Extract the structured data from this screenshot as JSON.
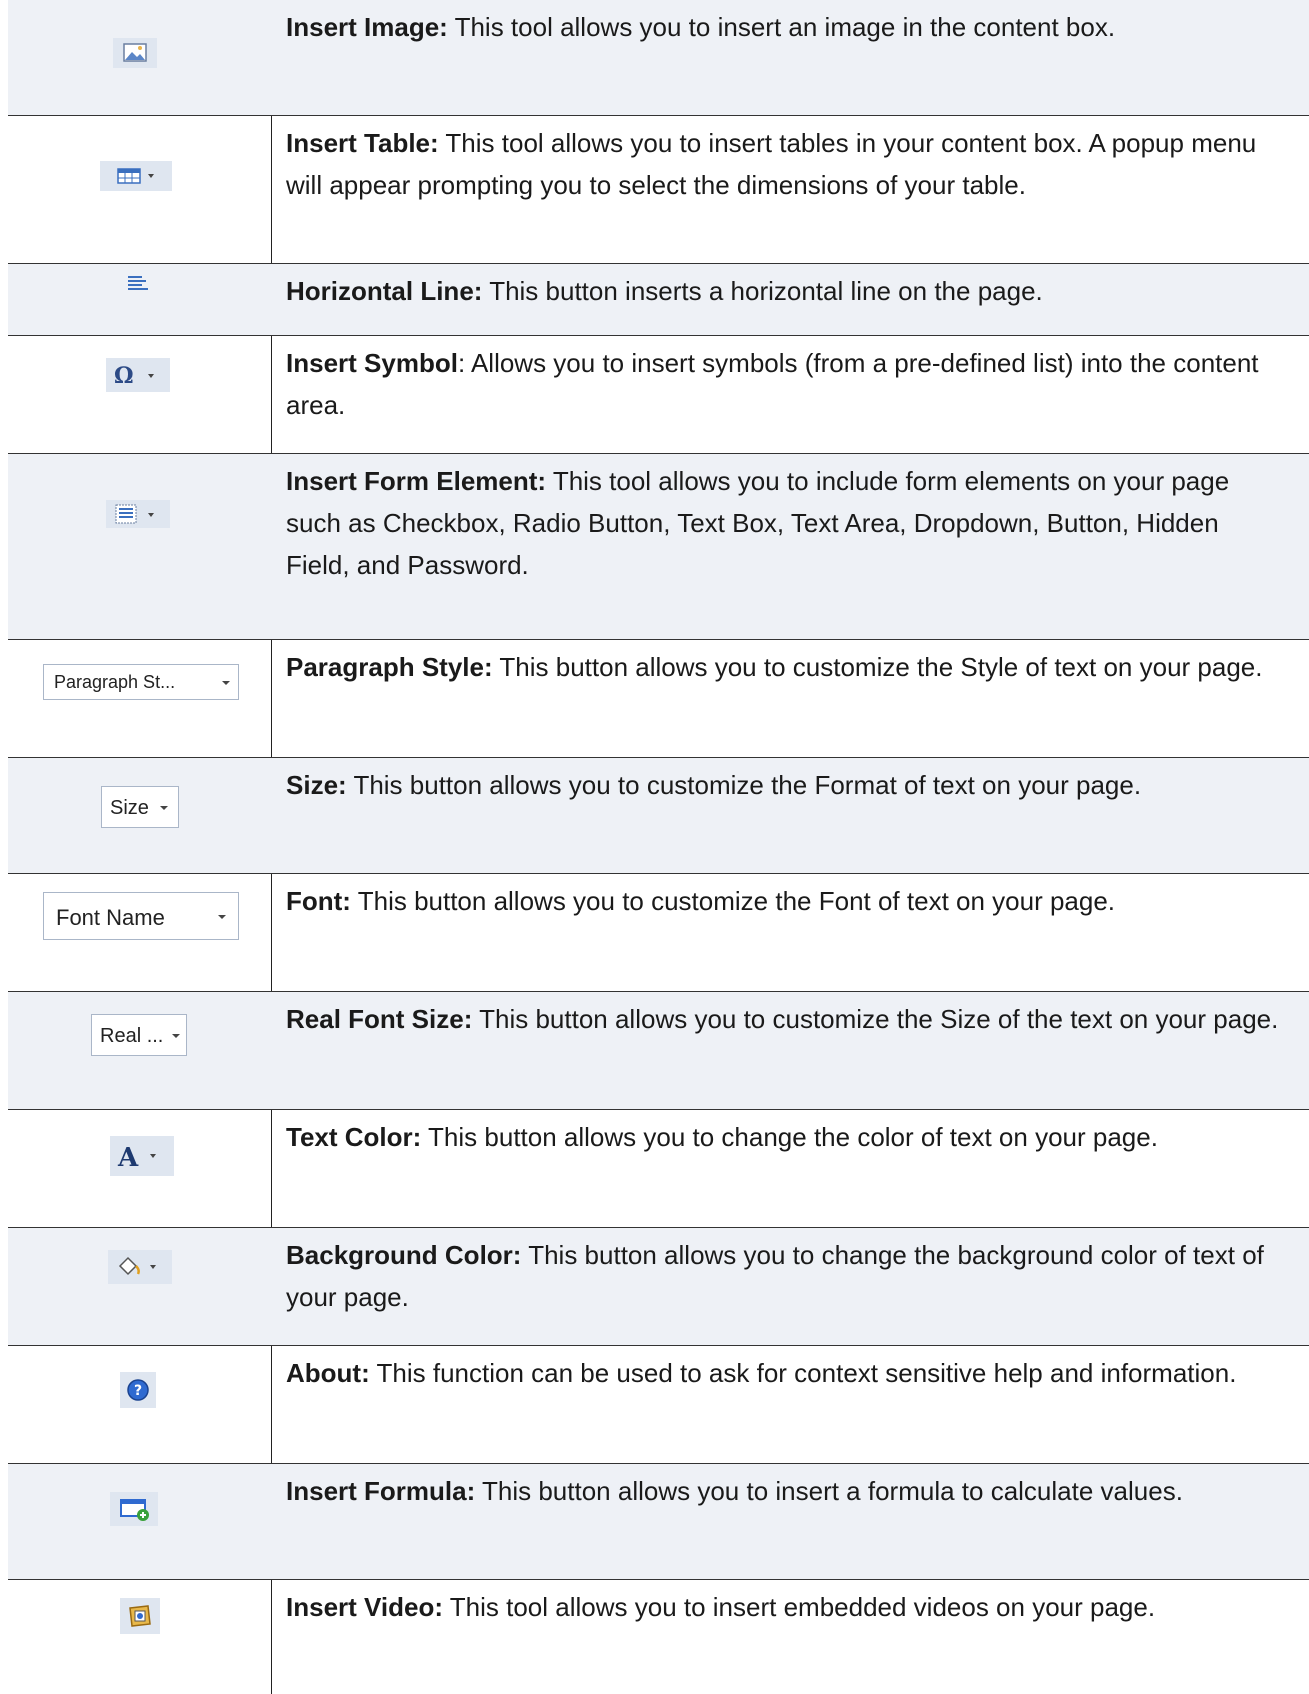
{
  "rows": [
    {
      "icon": "insert-image-icon",
      "title": "Insert Image:",
      "desc": " This tool allows you to insert an image in the content box."
    },
    {
      "icon": "insert-table-icon",
      "title": "Insert Table:",
      "desc": " This tool allows you to insert tables in your content box. A popup menu will appear prompting you to select the dimensions of your table."
    },
    {
      "icon": "horizontal-line-icon",
      "title": "Horizontal Line:",
      "desc": " This button inserts a horizontal line on the page."
    },
    {
      "icon": "omega-symbol-icon",
      "title": "Insert Symbol",
      "desc": ": Allows you to insert symbols (from a pre-defined list) into the content area."
    },
    {
      "icon": "form-element-icon",
      "title": "Insert Form Element:",
      "desc": " This tool allows you to include form elements on your page such as Checkbox, Radio Button, Text Box, Text Area, Dropdown, Button, Hidden Field, and Password."
    },
    {
      "icon": "paragraph-style-dropdown",
      "dropdown_label": "Paragraph St...",
      "title": "Paragraph Style:",
      "desc": " This button allows you to customize the Style of text on your page."
    },
    {
      "icon": "size-dropdown",
      "dropdown_label": "Size",
      "title": "Size:",
      "desc": " This button allows you to customize the Format of text on your page."
    },
    {
      "icon": "font-name-dropdown",
      "dropdown_label": "Font Name",
      "title": "Font:",
      "desc": " This button allows you to customize the Font of text on your page."
    },
    {
      "icon": "real-font-size-dropdown",
      "dropdown_label": "Real ...",
      "title": "Real Font Size:",
      "desc": " This button allows you to customize the Size of the text on your page."
    },
    {
      "icon": "text-color-icon",
      "title": "Text Color:",
      "desc": " This button allows you to change the color of text on your page."
    },
    {
      "icon": "paint-bucket-icon",
      "title": "Background Color:",
      "desc": " This button allows you to change the background color of text of your page."
    },
    {
      "icon": "help-icon",
      "title": "About:",
      "desc": " This function can be used to ask for context sensitive help and information."
    },
    {
      "icon": "insert-formula-icon",
      "title": "Insert Formula:",
      "desc": " This button allows you to insert a formula to calculate values."
    },
    {
      "icon": "insert-video-icon",
      "title": "Insert Video:",
      "desc": " This tool allows you to insert embedded videos on your page."
    }
  ],
  "colors": {
    "row_shade": "#eef1f6",
    "border": "#333333",
    "icon_blue": "#3a6fbf"
  }
}
